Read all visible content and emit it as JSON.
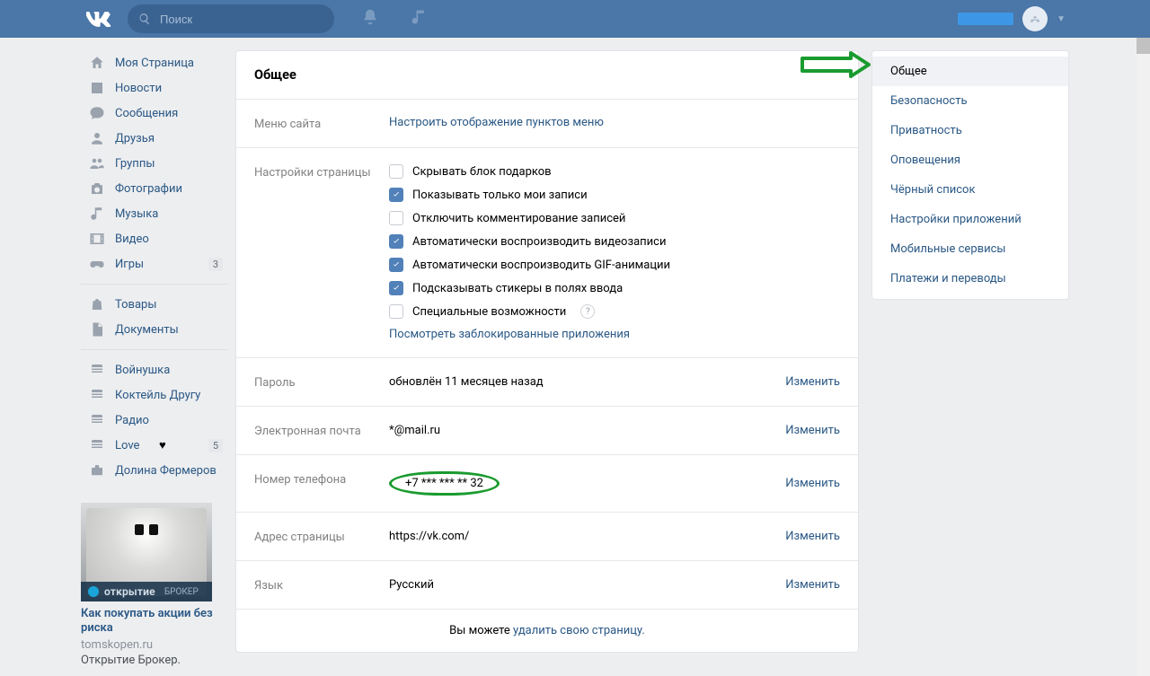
{
  "header": {
    "search_placeholder": "Поиск"
  },
  "leftnav": {
    "items": [
      "Моя Страница",
      "Новости",
      "Сообщения",
      "Друзья",
      "Группы",
      "Фотографии",
      "Музыка",
      "Видео",
      "Игры"
    ],
    "badge_games": "3",
    "sec2": [
      "Товары",
      "Документы"
    ],
    "sec3": [
      "Войнушка",
      "Коктейль Другу",
      "Радио",
      "Love",
      "Долина Фермеров"
    ],
    "badge_love": "5"
  },
  "ad": {
    "brand": "открытие",
    "brand_sub": "БРОКЕР",
    "title": "Как покупать акции без риска",
    "domain": "tomskopen.ru",
    "desc": "Открытие Брокер."
  },
  "settings": {
    "title": "Общее",
    "menu_label": "Меню сайта",
    "menu_link": "Настроить отображение пунктов меню",
    "page_label": "Настройки страницы",
    "checks": [
      {
        "checked": false,
        "text": "Скрывать блок подарков"
      },
      {
        "checked": true,
        "text": "Показывать только мои записи"
      },
      {
        "checked": false,
        "text": "Отключить комментирование записей"
      },
      {
        "checked": true,
        "text": "Автоматически воспроизводить видеозаписи"
      },
      {
        "checked": true,
        "text": "Автоматически воспроизводить GIF-анимации"
      },
      {
        "checked": true,
        "text": "Подсказывать стикеры в полях ввода"
      },
      {
        "checked": false,
        "text": "Специальные возможности"
      }
    ],
    "blocked_apps": "Посмотреть заблокированные приложения",
    "rows": {
      "password": {
        "label": "Пароль",
        "value": "обновлён 11 месяцев назад",
        "action": "Изменить"
      },
      "email": {
        "label": "Электронная почта",
        "value": "*@mail.ru",
        "action": "Изменить"
      },
      "phone": {
        "label": "Номер телефона",
        "value": "+7 *** *** ** 32",
        "action": "Изменить"
      },
      "address": {
        "label": "Адрес страницы",
        "value": "https://vk.com/",
        "action": "Изменить"
      },
      "lang": {
        "label": "Язык",
        "value": "Русский",
        "action": "Изменить"
      }
    },
    "footer_pre": "Вы можете ",
    "footer_link": "удалить свою страницу."
  },
  "sidenav": [
    "Общее",
    "Безопасность",
    "Приватность",
    "Оповещения",
    "Чёрный список",
    "Настройки приложений",
    "Мобильные сервисы",
    "Платежи и переводы"
  ]
}
